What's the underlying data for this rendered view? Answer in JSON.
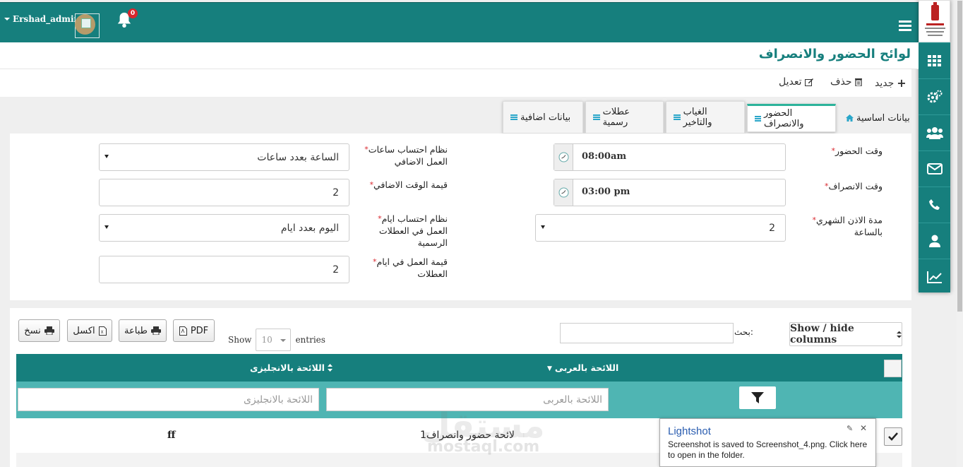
{
  "header": {
    "username": "Ershad_admin",
    "notifications_count": "0"
  },
  "page": {
    "title": "لوائح الحضور والانصراف"
  },
  "actions": {
    "new": "جديد",
    "delete": "حذف",
    "edit": "تعديل"
  },
  "tabs": [
    {
      "label": "بيانات اساسية",
      "icon": "home-icon"
    },
    {
      "label": "الحضور والانصراف",
      "icon": "menu-icon",
      "active": true
    },
    {
      "label": "الغياب والتاخير",
      "icon": "menu-icon"
    },
    {
      "label": "عطلات رسمية",
      "icon": "menu-icon"
    },
    {
      "label": "بيانات اضافية",
      "icon": "menu-icon"
    }
  ],
  "form": {
    "attendance_time": {
      "label": "وقت الحضور",
      "value": "08:00am"
    },
    "leave_time": {
      "label": "وقت الانصراف",
      "value": "03:00 pm"
    },
    "monthly_permission": {
      "label": "مدة الاذن الشهري بالساعة",
      "value": "2"
    },
    "overtime_system": {
      "label": "نظام احتساب ساعات العمل الاضافي",
      "value": "الساعة بعدد ساعات"
    },
    "overtime_value": {
      "label": "قيمة الوقت الاضافي",
      "value": "2"
    },
    "holiday_system": {
      "label": "نظام احتساب ايام العمل في العطلات الرسمية",
      "value": "اليوم بعدد ايام"
    },
    "holiday_value": {
      "label": "قيمة العمل في ايام العطلات",
      "value": "2"
    }
  },
  "toolbar": {
    "copy": "نسخ",
    "excel": "اكسل",
    "print": "طباعة",
    "pdf": "PDF",
    "show": "Show",
    "entries_value": "10",
    "entries": "entries",
    "search_label": "بحث:",
    "columns": "Show / hide columns"
  },
  "table": {
    "columns": [
      "اللائحة بالعربى",
      "اللائحة بالانجليزى"
    ],
    "filter_placeholders": [
      "اللائحة بالعربى",
      "اللائحة بالانجليزى"
    ],
    "rows": [
      {
        "arabic": "لائحة حضور وانصراف1",
        "english": "ff"
      }
    ]
  },
  "watermark": {
    "text_ar": "مستقل",
    "text_en": "mostaql.com"
  },
  "popup": {
    "title": "Lightshot",
    "message": "Screenshot is saved to Screenshot_4.png. Click here to open in the folder."
  },
  "colors": {
    "primary": "#167f7d",
    "accent": "#2cb39a",
    "filter_row": "#4fb5b3"
  }
}
